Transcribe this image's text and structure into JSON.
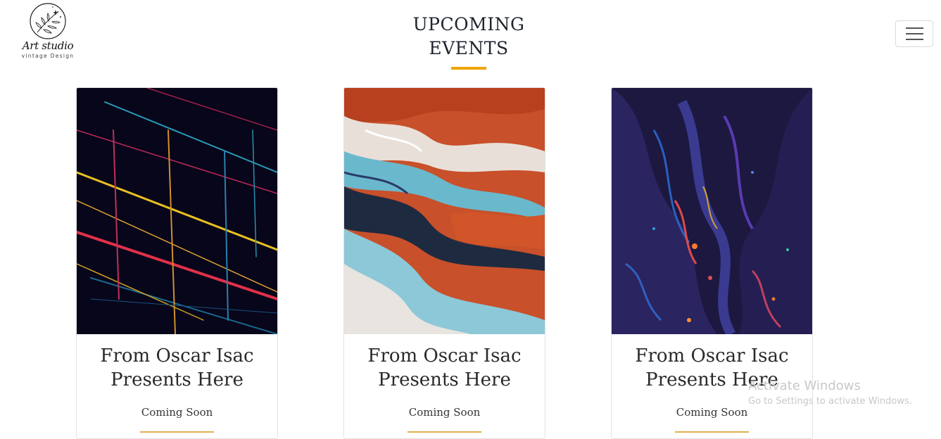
{
  "logo": {
    "title": "Art studio",
    "subtitle": "vintage Design"
  },
  "header": {
    "title_line1": "UPCOMING",
    "title_line2": "EVENTS",
    "accent_color": "#f0a500",
    "menu_icon": "hamburger-menu-icon"
  },
  "events": [
    {
      "title_line1": "From Oscar Isac",
      "title_line2": "Presents Here",
      "status": "Coming Soon"
    },
    {
      "title_line1": "From Oscar Isac",
      "title_line2": "Presents Here",
      "status": "Coming Soon"
    },
    {
      "title_line1": "From Oscar Isac",
      "title_line2": "Presents Here",
      "status": "Coming Soon"
    }
  ],
  "watermark": {
    "line1": "Activate Windows",
    "line2": "Go to Settings to activate Windows."
  }
}
